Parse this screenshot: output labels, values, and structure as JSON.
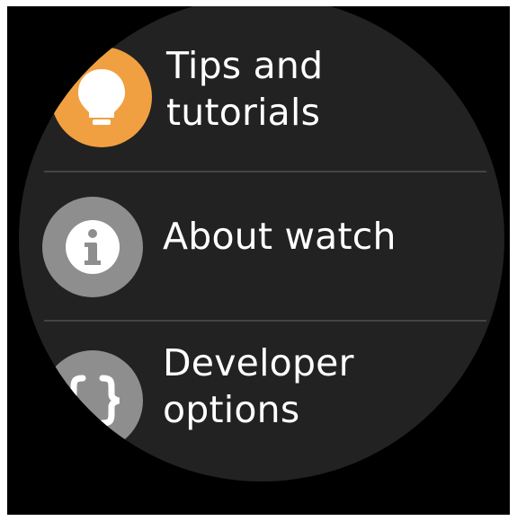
{
  "colors": {
    "background": "#222222",
    "text": "#ffffff",
    "divider": "#444444",
    "tips_icon_bg": "#f0a040",
    "gray_icon_bg": "#8e8e8e"
  },
  "menu": {
    "items": [
      {
        "label": "Tips and\ntutorials",
        "icon": "lightbulb-icon"
      },
      {
        "label": "About watch",
        "icon": "info-icon"
      },
      {
        "label": "Developer\noptions",
        "icon": "braces-icon"
      }
    ]
  }
}
